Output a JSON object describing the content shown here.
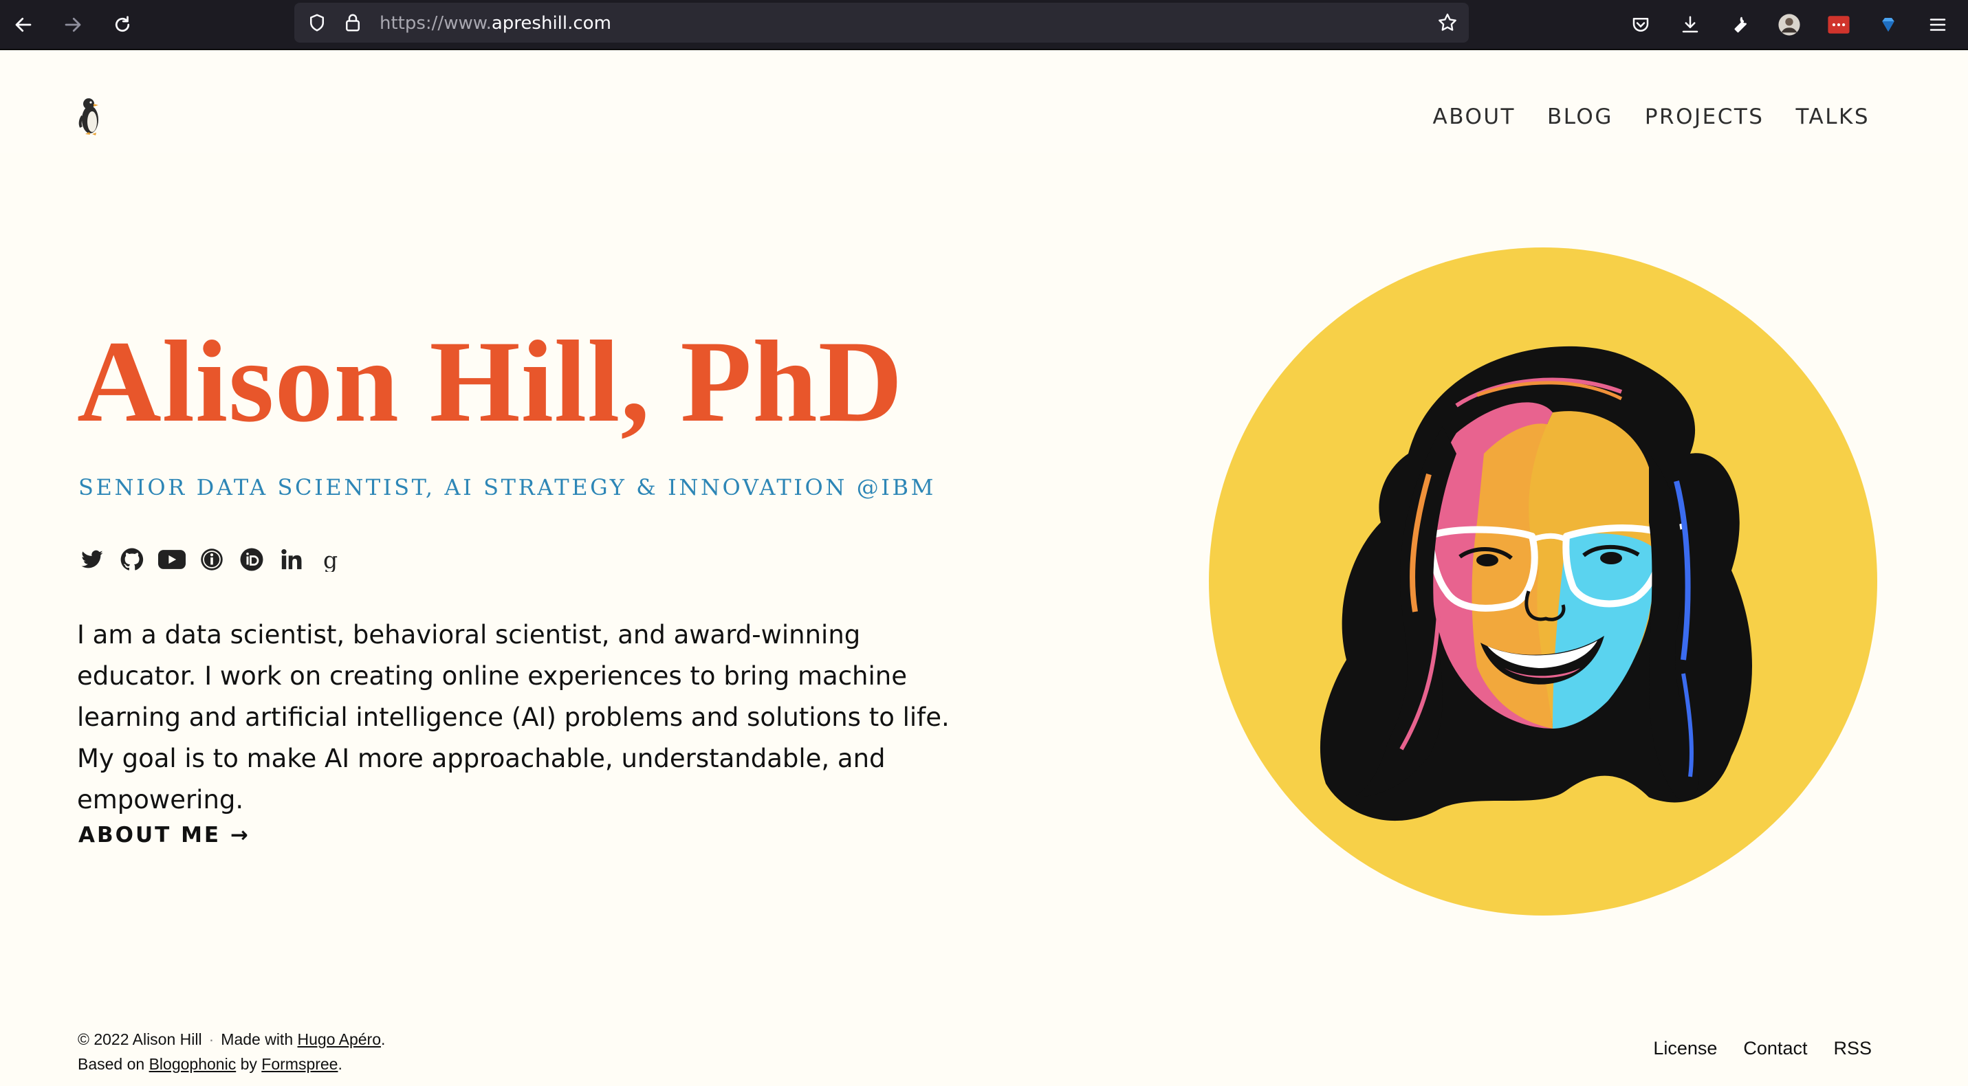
{
  "browser": {
    "url_prefix": "https://www.",
    "url_domain": "apreshill.com",
    "url_suffix": ".com"
  },
  "header": {
    "logo_icon": "penguin-icon",
    "nav": [
      {
        "label": "ABOUT"
      },
      {
        "label": "BLOG"
      },
      {
        "label": "PROJECTS"
      },
      {
        "label": "TALKS"
      }
    ]
  },
  "hero": {
    "title": "Alison Hill, PhD",
    "subtitle": "SENIOR DATA SCIENTIST, AI STRATEGY & INNOVATION @IBM",
    "bio": "I am a data scientist, behavioral scientist, and award-winning educator. I work on creating online experiences to bring machine learning and artificial intelligence (AI) problems and solutions to life. My goal is to make AI more approachable, understandable, and empowering.",
    "cta": "ABOUT ME →",
    "socials": [
      "twitter-icon",
      "github-icon",
      "youtube-icon",
      "info-icon",
      "orcid-icon",
      "linkedin-icon",
      "google-scholar-icon"
    ]
  },
  "footer": {
    "copyright": "© 2022 Alison Hill",
    "made_with": "Made with",
    "hugo_link": "Hugo Apéro",
    "based_on": "Based on",
    "blogophonic_link": "Blogophonic",
    "by": "by",
    "formspree_link": "Formspree",
    "links": [
      "License",
      "Contact",
      "RSS"
    ]
  },
  "colors": {
    "accent": "#e8562b",
    "subtitle": "#2d86b6",
    "background": "#fffdf6",
    "portrait_circle": "#f7d048"
  }
}
